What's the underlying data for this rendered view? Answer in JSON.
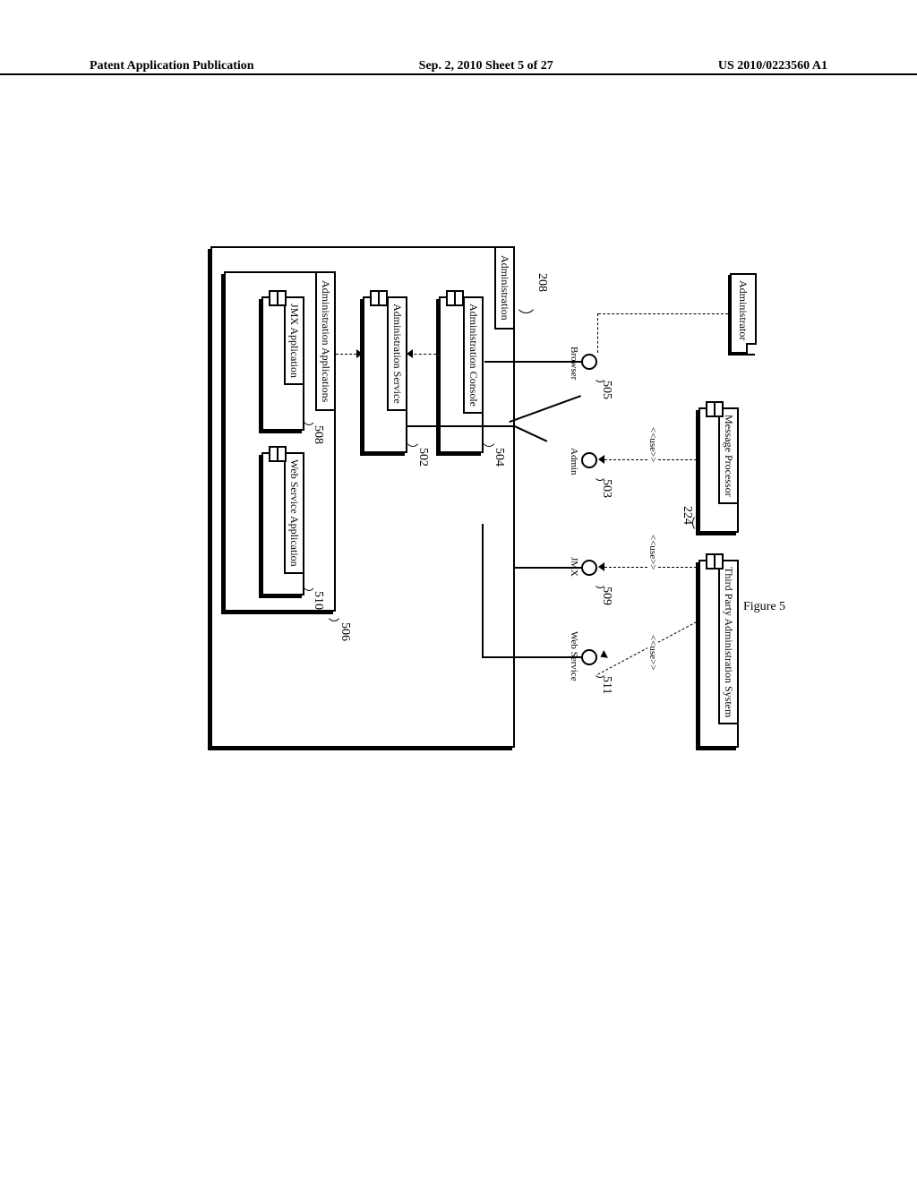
{
  "header": {
    "left": "Patent Application Publication",
    "center": "Sep. 2, 2010  Sheet 5 of 27",
    "right": "US 2010/0223560 A1"
  },
  "caption": "Figure 5",
  "ref": {
    "n208": "208",
    "n504": "504",
    "n502": "502",
    "n506": "506",
    "n508": "508",
    "n510": "510",
    "n505": "505",
    "n503": "503",
    "n509": "509",
    "n511": "511",
    "n224": "224"
  },
  "labels": {
    "administration": "Administration",
    "admin_console": "Administration Console",
    "admin_service": "Administration Service",
    "admin_apps": "Administration Applications",
    "jmx_app": "JMX Application",
    "ws_app": "Web Service Application",
    "administrator": "Administrator",
    "msg_proc": "Message Processor",
    "tpa": "Third Party Administration System",
    "browser": "Browser",
    "admin": "Admin",
    "jmx": "JMX",
    "webservice": "Web Service",
    "use": "<<use>>"
  }
}
